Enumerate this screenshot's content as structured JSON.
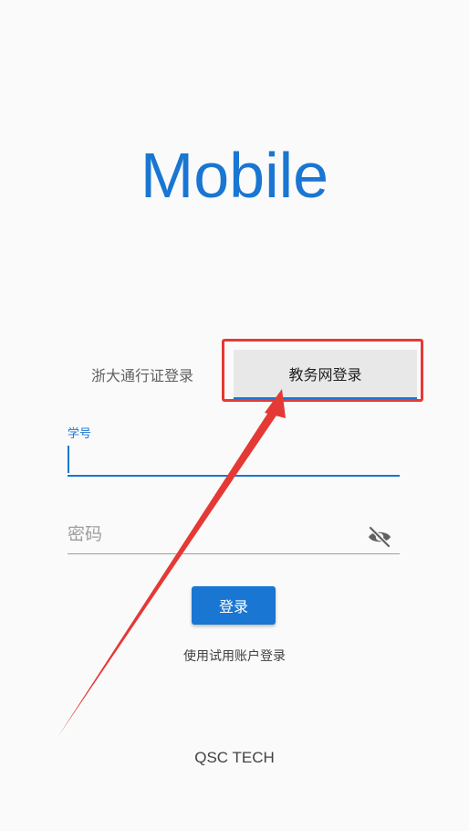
{
  "app": {
    "title": "Mobile"
  },
  "tabs": [
    {
      "label": "浙大通行证登录",
      "selected": false
    },
    {
      "label": "教务网登录",
      "selected": true
    }
  ],
  "form": {
    "student_id": {
      "label": "学号",
      "value": ""
    },
    "password": {
      "placeholder": "密码",
      "value": "",
      "toggle_icon": "eye-off-icon"
    },
    "login_label": "登录",
    "trial_link": "使用试用账户登录"
  },
  "footer": {
    "text": "QSC TECH"
  },
  "colors": {
    "accent": "#1976d2",
    "annotation": "#e53935",
    "background": "#fafafa"
  }
}
